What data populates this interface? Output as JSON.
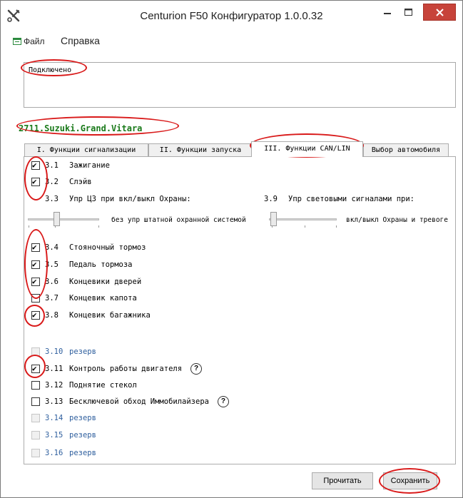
{
  "window": {
    "title": "Centurion F50 Конфигуратор 1.0.0.32",
    "app_icon": "tools-icon",
    "controls": [
      "minimize-icon",
      "maximize-icon",
      "close-icon"
    ],
    "close_color": "#c7433a"
  },
  "menu": {
    "file_label": "Файл",
    "help_label": "Справка"
  },
  "status": {
    "text": "Подключено"
  },
  "car": {
    "label": "2711.Suzuki.Grand.Vitara",
    "color": "#1a7a1a"
  },
  "tabs": [
    {
      "label": "I. Функции сигнализации",
      "active": false
    },
    {
      "label": "II. Функции запуска",
      "active": false
    },
    {
      "label": "III. Функции CAN/LIN",
      "active": true
    },
    {
      "label": "Выбор автомобиля",
      "active": false
    }
  ],
  "options": {
    "o31": {
      "num": "3.1",
      "label": "Зажигание",
      "checked": true
    },
    "o32": {
      "num": "3.2",
      "label": "Слэйв",
      "checked": true
    },
    "o34": {
      "num": "3.4",
      "label": "Стояночный тормоз",
      "checked": true
    },
    "o35": {
      "num": "3.5",
      "label": "Педаль тормоза",
      "checked": true
    },
    "o36": {
      "num": "3.6",
      "label": "Концевики дверей",
      "checked": true
    },
    "o37": {
      "num": "3.7",
      "label": "Концевик капота",
      "checked": false
    },
    "o38": {
      "num": "3.8",
      "label": "Концевик багажника",
      "checked": true
    },
    "o310": {
      "num": "3.10",
      "label": "резерв",
      "checked": false,
      "disabled": true
    },
    "o311": {
      "num": "3.11",
      "label": "Контроль работы двигателя",
      "checked": true,
      "help": "?"
    },
    "o312": {
      "num": "3.12",
      "label": "Поднятие стекол",
      "checked": false
    },
    "o313": {
      "num": "3.13",
      "label": "Бесключевой обход Иммобилайзера",
      "checked": false,
      "help": "?"
    },
    "o314": {
      "num": "3.14",
      "label": "резерв",
      "checked": false,
      "disabled": true
    },
    "o315": {
      "num": "3.15",
      "label": "резерв",
      "checked": false,
      "disabled": true
    },
    "o316": {
      "num": "3.16",
      "label": "резерв",
      "checked": false,
      "disabled": true
    }
  },
  "slider33": {
    "num": "3.3",
    "title": "Упр ЦЗ при вкл/выкл Охраны:",
    "value_label": "без упр штатной охранной системой",
    "level": 0
  },
  "slider39": {
    "num": "3.9",
    "title": "Упр световыми сигналами при:",
    "value_label": "вкл/выкл Охраны и тревоге",
    "level": 0
  },
  "buttons": {
    "read": "Прочитать",
    "save": "Сохранить"
  },
  "annotation_color": "#d91a1a"
}
